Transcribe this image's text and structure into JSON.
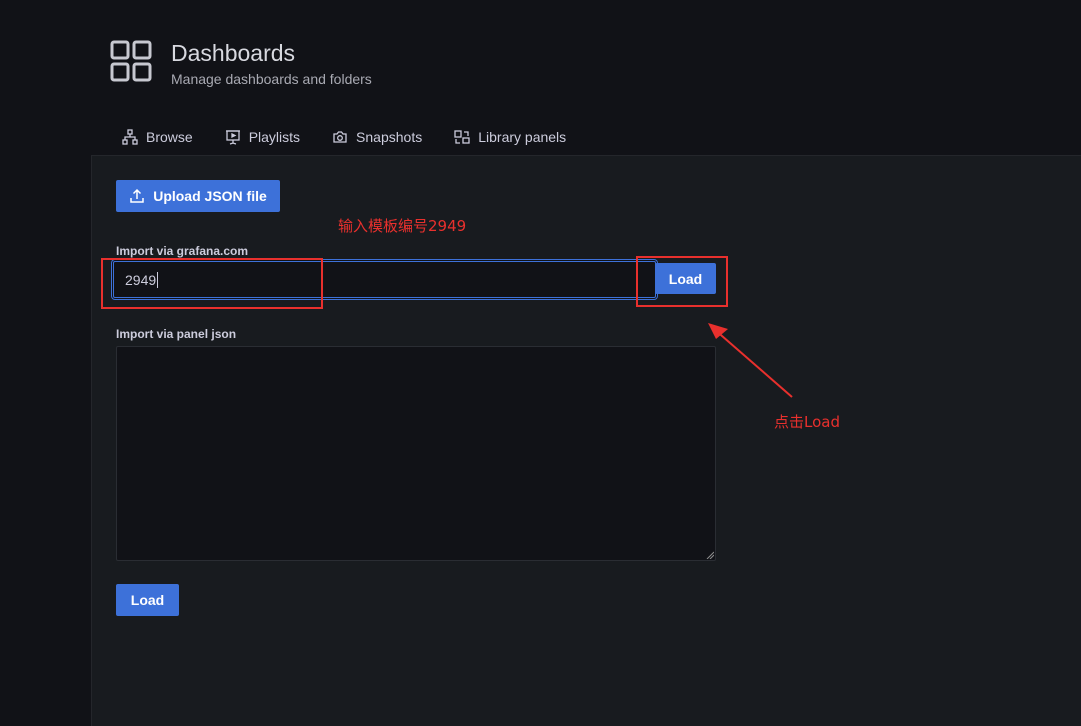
{
  "header": {
    "title": "Dashboards",
    "subtitle": "Manage dashboards and folders",
    "icon": "dashboards-grid-icon"
  },
  "tabs": [
    {
      "label": "Browse",
      "icon": "sitemap-icon"
    },
    {
      "label": "Playlists",
      "icon": "presentation-play-icon"
    },
    {
      "label": "Snapshots",
      "icon": "camera-icon"
    },
    {
      "label": "Library panels",
      "icon": "library-panel-icon"
    }
  ],
  "import": {
    "upload_label": "Upload JSON file",
    "grafana_label": "Import via grafana.com",
    "grafana_value": "2949",
    "grafana_load_label": "Load",
    "panel_json_label": "Import via panel json",
    "panel_json_value": "",
    "bottom_load_label": "Load"
  },
  "annotations": {
    "input_hint": "输入模板编号2949",
    "load_hint": "点击Load",
    "color": "#e8302d"
  },
  "colors": {
    "primary": "#3d71d9",
    "background": "#111217",
    "panel": "#181b1f"
  }
}
